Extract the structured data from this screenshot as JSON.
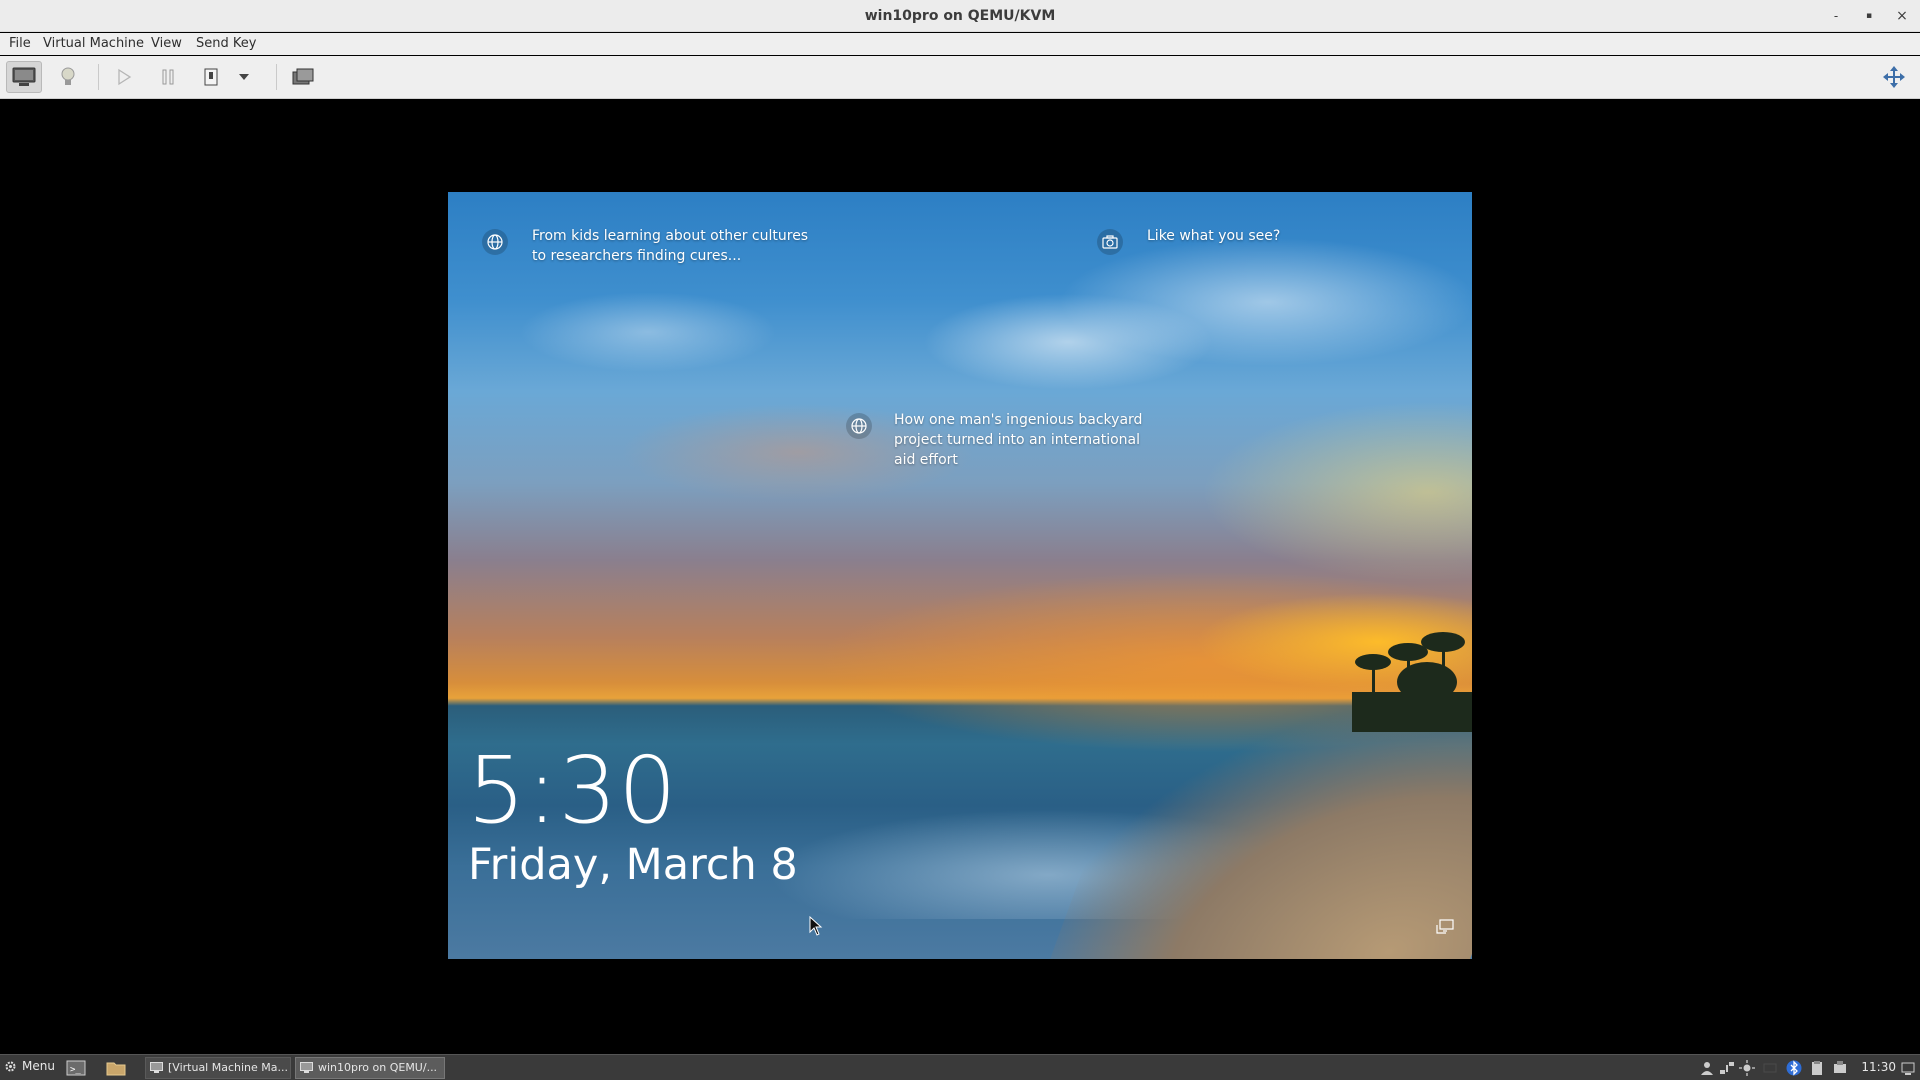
{
  "window": {
    "title": "win10pro on QEMU/KVM",
    "controls": {
      "minimize": "-",
      "maximize": "▪",
      "close": "×"
    }
  },
  "menubar": {
    "items": [
      "File",
      "Virtual Machine",
      "View",
      "Send Key"
    ]
  },
  "toolbar": {
    "buttons": [
      "console-icon",
      "lightbulb-icon",
      "run-icon",
      "pause-icon",
      "shutdown-icon",
      "dropdown-arrow-icon",
      "snapshot-icon",
      "fullscreen-icon"
    ]
  },
  "lockscreen": {
    "spotlight_top_left": "From kids learning about other cultures to researchers finding cures...",
    "spotlight_top_right": "Like what you see?",
    "spotlight_middle": "How one man's ingenious backyard project turned into an international aid effort",
    "time": "5:30",
    "date": "Friday, March 8",
    "colors": {
      "sky": "#3f8fce",
      "sunset": "#e8a23a",
      "sea": "#2f6d8d"
    }
  },
  "taskbar": {
    "menu_label": "Menu",
    "tasks": [
      {
        "label": "[Virtual Machine Ma...",
        "active": false
      },
      {
        "label": "win10pro on QEMU/...",
        "active": true
      }
    ],
    "clock": "11:30",
    "tray": [
      "user-icon",
      "network-icon",
      "brightness-icon",
      "bluetooth-icon",
      "clipboard-icon",
      "updates-icon",
      "show-desktop-icon"
    ]
  }
}
